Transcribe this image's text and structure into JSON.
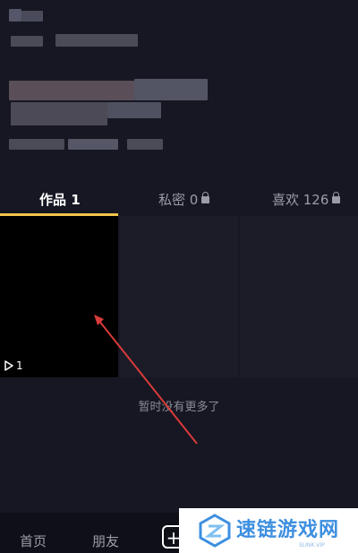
{
  "tabs": [
    {
      "label": "作品 1",
      "locked": false
    },
    {
      "label": "私密 0",
      "locked": true
    },
    {
      "label": "喜欢 126",
      "locked": true
    }
  ],
  "video": {
    "play_count": "1"
  },
  "empty_text": "暂时没有更多了",
  "nav": {
    "home": "首页",
    "friends": "朋友",
    "plus": "+"
  },
  "watermark": {
    "title": "速链游戏网",
    "sub": "SLINK.VIP"
  },
  "colors": {
    "bg": "#161722",
    "accent": "#f3c44a",
    "arrow": "#d93a3a"
  }
}
